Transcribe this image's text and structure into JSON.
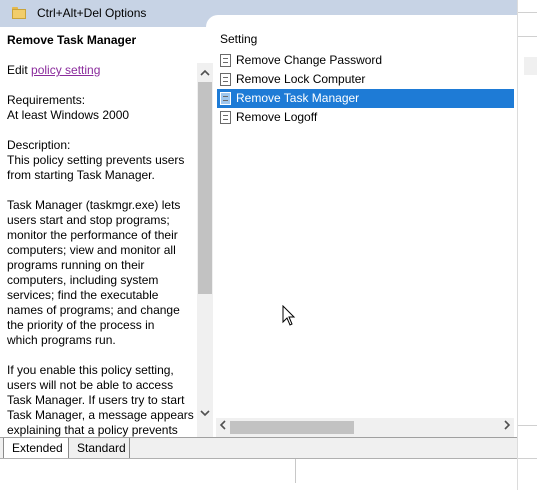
{
  "window": {
    "title": "Ctrl+Alt+Del Options"
  },
  "description": {
    "heading": "Remove Task Manager",
    "edit_prefix": "Edit ",
    "edit_link": "policy setting ",
    "requirements_label": "Requirements:",
    "requirements_value": "At least Windows 2000",
    "description_label": "Description:",
    "lines": [
      "This policy setting prevents users",
      "from starting Task Manager.",
      "",
      "Task Manager (taskmgr.exe) lets",
      "users start and stop programs;",
      "monitor the performance of their",
      "computers; view and monitor all",
      "programs running on their",
      "computers, including system",
      "services; find the executable",
      "names of programs; and change",
      "the priority of the process in",
      "which programs run.",
      "",
      "If you enable this policy setting,",
      "users will not be able to access",
      "Task Manager. If users try to start",
      "Task Manager, a message appears",
      "explaining that a policy prevents"
    ]
  },
  "settings": {
    "column_header": "Setting",
    "items": [
      {
        "label": "Remove Change Password",
        "selected": false
      },
      {
        "label": "Remove Lock Computer",
        "selected": false
      },
      {
        "label": "Remove Task Manager",
        "selected": true
      },
      {
        "label": "Remove Logoff",
        "selected": false
      }
    ]
  },
  "tabs": [
    {
      "label": "Extended",
      "active": true
    },
    {
      "label": "Standard",
      "active": false
    }
  ],
  "icons": {
    "title": "folder-icon",
    "setting": "policy-setting-icon",
    "scroll_up": "chevron-up-icon",
    "scroll_down": "chevron-down-icon",
    "scroll_left": "chevron-left-icon",
    "scroll_right": "chevron-right-icon"
  },
  "colors": {
    "titlebar": "#c7d3e5",
    "selection": "#1e7bd6",
    "link": "#8a2b9c"
  }
}
